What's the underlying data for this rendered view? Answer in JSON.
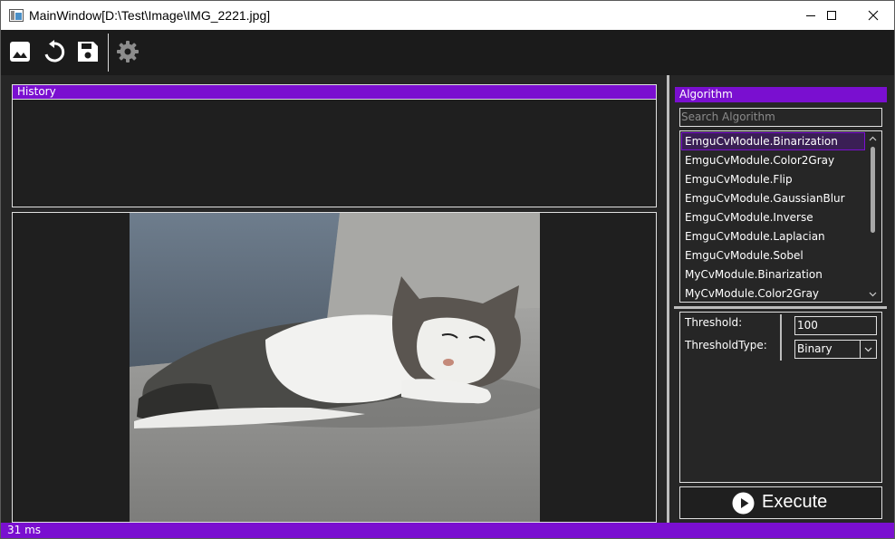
{
  "window": {
    "title": "MainWindow[D:\\Test\\Image\\IMG_2221.jpg]"
  },
  "toolbar": {
    "buttons": [
      "open-image-icon",
      "undo-icon",
      "save-icon",
      "settings-icon"
    ]
  },
  "history": {
    "title": "History"
  },
  "algorithm": {
    "title": "Algorithm",
    "search_placeholder": "Search Algorithm",
    "items": [
      "EmguCvModule.Binarization",
      "EmguCvModule.Color2Gray",
      "EmguCvModule.Flip",
      "EmguCvModule.GaussianBlur",
      "EmguCvModule.Inverse",
      "EmguCvModule.Laplacian",
      "EmguCvModule.Sobel",
      "MyCvModule.Binarization",
      "MyCvModule.Color2Gray"
    ],
    "selected_index": 0
  },
  "params": {
    "threshold_label": "Threshold:",
    "threshold_value": "100",
    "threshold_type_label": "ThresholdType:",
    "threshold_type_value": "Binary"
  },
  "execute": {
    "label": "Execute"
  },
  "status": {
    "text": "31 ms"
  },
  "colors": {
    "accent": "#7a0fd0",
    "background": "#262626",
    "panel": "#1f1f1f"
  }
}
